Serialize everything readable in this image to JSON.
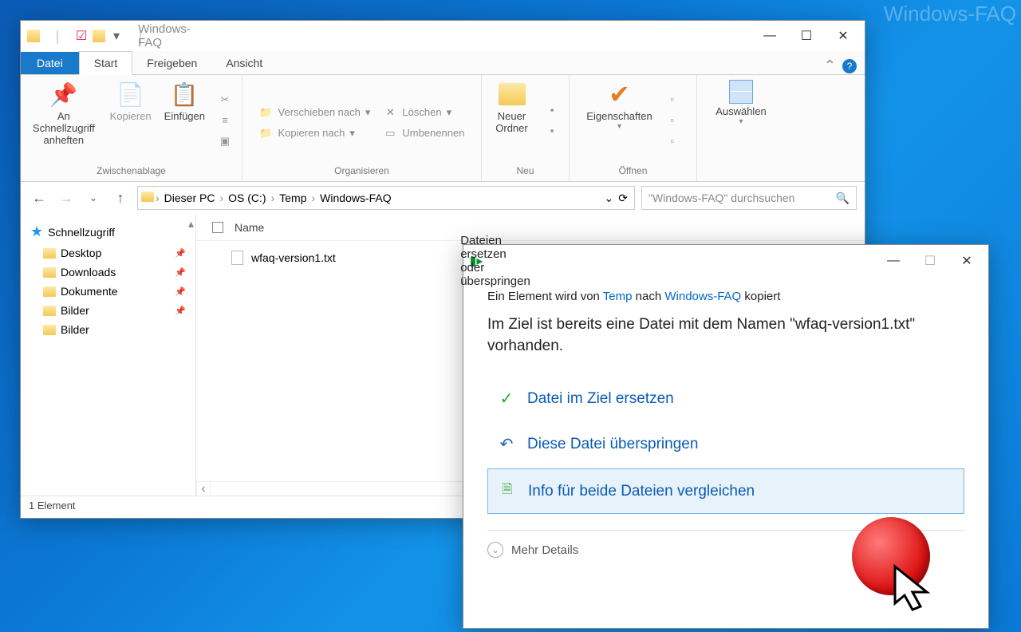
{
  "watermark": "Windows-FAQ",
  "explorer": {
    "title": "Windows-FAQ",
    "tabs": {
      "file": "Datei",
      "start": "Start",
      "share": "Freigeben",
      "view": "Ansicht"
    },
    "ribbon": {
      "clipboard": {
        "label": "Zwischenablage",
        "pin": "An Schnellzugriff anheften",
        "copy": "Kopieren",
        "paste": "Einfügen"
      },
      "organize": {
        "label": "Organisieren",
        "moveTo": "Verschieben nach",
        "copyTo": "Kopieren nach",
        "delete": "Löschen",
        "rename": "Umbenennen"
      },
      "new": {
        "label": "Neu",
        "newFolder": "Neuer Ordner"
      },
      "open": {
        "label": "Öffnen",
        "properties": "Eigenschaften"
      },
      "select": {
        "label": "Auswählen"
      }
    },
    "path": [
      "Dieser PC",
      "OS (C:)",
      "Temp",
      "Windows-FAQ"
    ],
    "searchPlaceholder": "\"Windows-FAQ\" durchsuchen",
    "nav": {
      "quickaccess": "Schnellzugriff",
      "items": [
        "Desktop",
        "Downloads",
        "Dokumente",
        "Bilder",
        "Bilder"
      ]
    },
    "columns": {
      "name": "Name"
    },
    "files": [
      "wfaq-version1.txt"
    ],
    "status": "1 Element"
  },
  "dialog": {
    "title": "Dateien ersetzen oder überspringen",
    "copyPrefix": "Ein Element wird von ",
    "copySrc": "Temp",
    "copyMid": " nach ",
    "copyDst": "Windows-FAQ",
    "copySuffix": " kopiert",
    "message": "Im Ziel ist bereits eine Datei mit dem Namen \"wfaq-version1.txt\" vorhanden.",
    "optReplace": "Datei im Ziel ersetzen",
    "optSkip": "Diese Datei überspringen",
    "optCompare": "Info für beide Dateien vergleichen",
    "more": "Mehr Details"
  }
}
